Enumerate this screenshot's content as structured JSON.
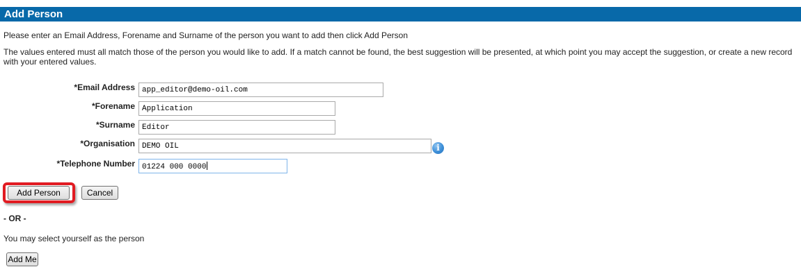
{
  "header": {
    "title": "Add Person"
  },
  "intro": {
    "line1": "Please enter an Email Address, Forename and Surname of the person you want to add then click Add Person",
    "line2": "The values entered must all match those of the person you would like to add. If a match cannot be found, the best suggestion will be presented, at which point you may accept the suggestion, or create a new record with your entered values."
  },
  "form": {
    "email": {
      "label": "*Email Address",
      "value": "app_editor@demo-oil.com"
    },
    "forename": {
      "label": "*Forename",
      "value": "Application"
    },
    "surname": {
      "label": "*Surname",
      "value": "Editor"
    },
    "organisation": {
      "label": "*Organisation",
      "value": "DEMO OIL",
      "info_icon": "info-icon"
    },
    "telephone": {
      "label": "*Telephone Number",
      "value": "01224 000 0000"
    }
  },
  "actions": {
    "add_person_label": "Add Person",
    "cancel_label": "Cancel",
    "highlight_color": "#e11b22"
  },
  "alternative": {
    "or_label": "- OR -",
    "self_text": "You may select yourself as the person",
    "add_me_label": "Add Me"
  },
  "colors": {
    "header_bg": "#0869a9"
  }
}
